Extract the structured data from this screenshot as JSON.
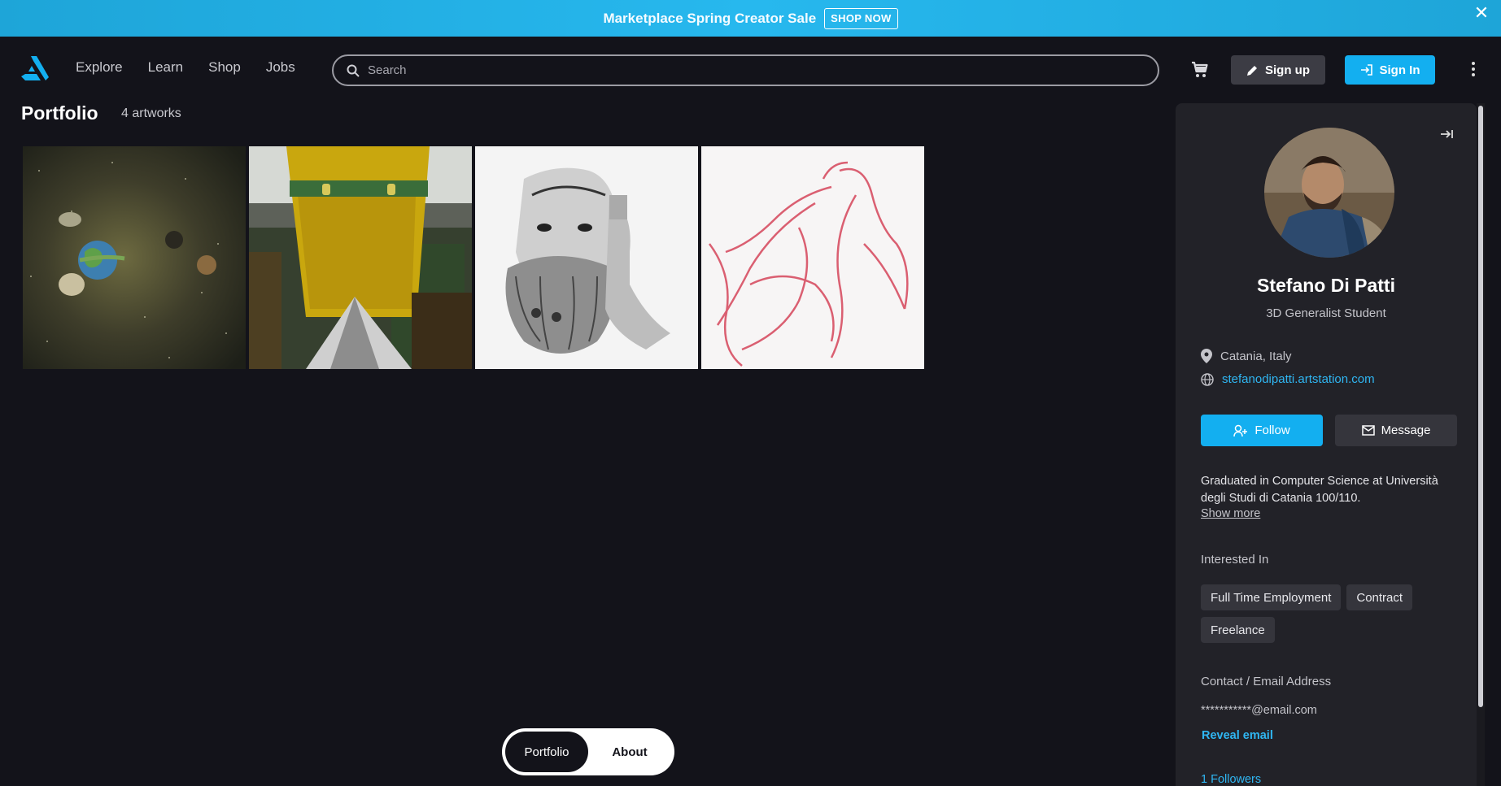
{
  "banner": {
    "text": "Marketplace Spring Creator Sale",
    "cta": "SHOP NOW",
    "close_glyph": "✕"
  },
  "nav": {
    "links": [
      "Explore",
      "Learn",
      "Shop",
      "Jobs"
    ],
    "search_placeholder": "Search",
    "signup_label": "Sign up",
    "signin_label": "Sign In"
  },
  "portfolio": {
    "title": "Portfolio",
    "count": "4 artworks",
    "artworks": [
      {
        "icon": "space-scene"
      },
      {
        "icon": "yellow-robot"
      },
      {
        "icon": "pencil-sketch-face"
      },
      {
        "icon": "red-sketch-figure"
      }
    ]
  },
  "toggle": {
    "active": "Portfolio",
    "inactive": "About"
  },
  "profile": {
    "name": "Stefano Di Patti",
    "role": "3D Generalist Student",
    "location": "Catania, Italy",
    "website": "stefanodipatti.artstation.com",
    "follow_label": "Follow",
    "message_label": "Message",
    "bio": "Graduated in Computer Science at Università degli Studi di Catania 100/110.",
    "show_more": "Show more",
    "interested_label": "Interested In",
    "interests": [
      "Full Time Employment",
      "Contract",
      "Freelance"
    ],
    "contact_label": "Contact / Email Address",
    "email": "***********@email.com",
    "reveal_label": "Reveal email",
    "followers": "1 Followers"
  },
  "colors": {
    "accent": "#13aff0",
    "background": "#13131a",
    "sidebar": "#222228",
    "banner": "#27b8ee"
  }
}
